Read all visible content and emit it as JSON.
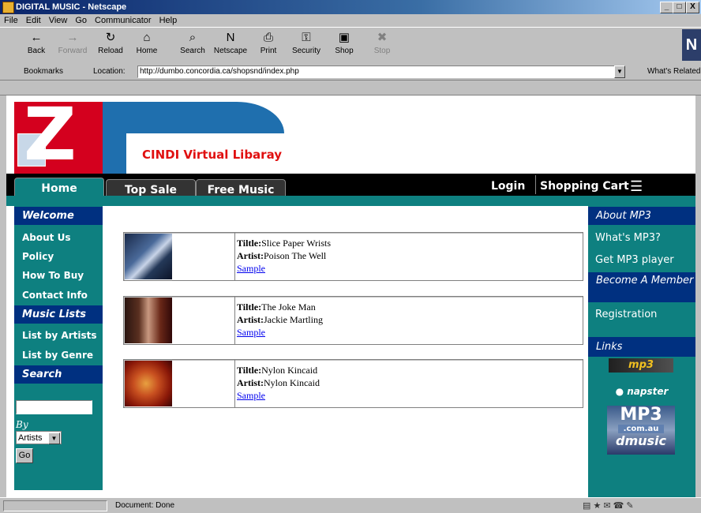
{
  "window": {
    "title": "DIGITAL MUSIC - Netscape",
    "min_label": "_",
    "max_label": "□",
    "close_label": "X"
  },
  "menu": [
    "File",
    "Edit",
    "View",
    "Go",
    "Communicator",
    "Help"
  ],
  "toolbar": [
    {
      "label": "Back",
      "icon": "back-arrow-icon",
      "glyph": "←",
      "enabled": true
    },
    {
      "label": "Forward",
      "icon": "forward-arrow-icon",
      "glyph": "→",
      "enabled": false
    },
    {
      "label": "Reload",
      "icon": "reload-icon",
      "glyph": "↻",
      "enabled": true
    },
    {
      "label": "Home",
      "icon": "home-icon",
      "glyph": "⌂",
      "enabled": true
    },
    {
      "label": "Search",
      "icon": "search-icon",
      "glyph": "⌕",
      "enabled": true
    },
    {
      "label": "Netscape",
      "icon": "netscape-icon",
      "glyph": "N",
      "enabled": true
    },
    {
      "label": "Print",
      "icon": "print-icon",
      "glyph": "⎙",
      "enabled": true
    },
    {
      "label": "Security",
      "icon": "lock-icon",
      "glyph": "⚿",
      "enabled": true
    },
    {
      "label": "Shop",
      "icon": "shop-icon",
      "glyph": "▣",
      "enabled": true
    },
    {
      "label": "Stop",
      "icon": "stop-icon",
      "glyph": "✖",
      "enabled": false
    }
  ],
  "locationbar": {
    "bookmarks_label": "Bookmarks",
    "location_label": "Location:",
    "url": "http://dumbo.concordia.ca/shopsnd/index.php",
    "related_label": "What's Related"
  },
  "site": {
    "title": "CINDI Virtual Libaray",
    "logo_letter": "Z",
    "nav": {
      "home": "Home",
      "top_sale": "Top Sale",
      "free_music": "Free Music",
      "login": "Login",
      "cart": "Shopping Cart",
      "cart_glyph": "☰"
    },
    "left": {
      "welcome": "Welcome",
      "welcome_items": [
        "About Us",
        "Policy",
        "How To Buy",
        "Contact Info"
      ],
      "music_lists": "Music Lists",
      "music_items": [
        "List by Artists",
        "List by Genre"
      ],
      "search": "Search",
      "by_label": "By",
      "by_value": "Artists",
      "go_label": "Go"
    },
    "right": {
      "about": "About MP3",
      "about_items": [
        "What's MP3?",
        "Get MP3 player"
      ],
      "become": "Become A Member",
      "become_items": [
        "Registration"
      ],
      "links": "Links",
      "link_logos": [
        "mp3",
        "napster",
        "MP3",
        ".com.au",
        "dmusic"
      ]
    },
    "products": [
      {
        "title_label": "Tiltle:",
        "title": "Slice Paper Wrists",
        "artist_label": "Artist:",
        "artist": "Poison The Well",
        "sample": "Sample"
      },
      {
        "title_label": "Tiltle:",
        "title": "The Joke Man",
        "artist_label": "Artist:",
        "artist": "Jackie Martling",
        "sample": "Sample"
      },
      {
        "title_label": "Tiltle:",
        "title": "Nylon Kincaid",
        "artist_label": "Artist:",
        "artist": "Nylon Kincaid",
        "sample": "Sample"
      }
    ]
  },
  "status": {
    "text": "Document: Done"
  },
  "colors": {
    "teal": "#0e8080",
    "navy": "#003080",
    "brand_red": "#d4001e",
    "brand_blue": "#1f6fae"
  }
}
